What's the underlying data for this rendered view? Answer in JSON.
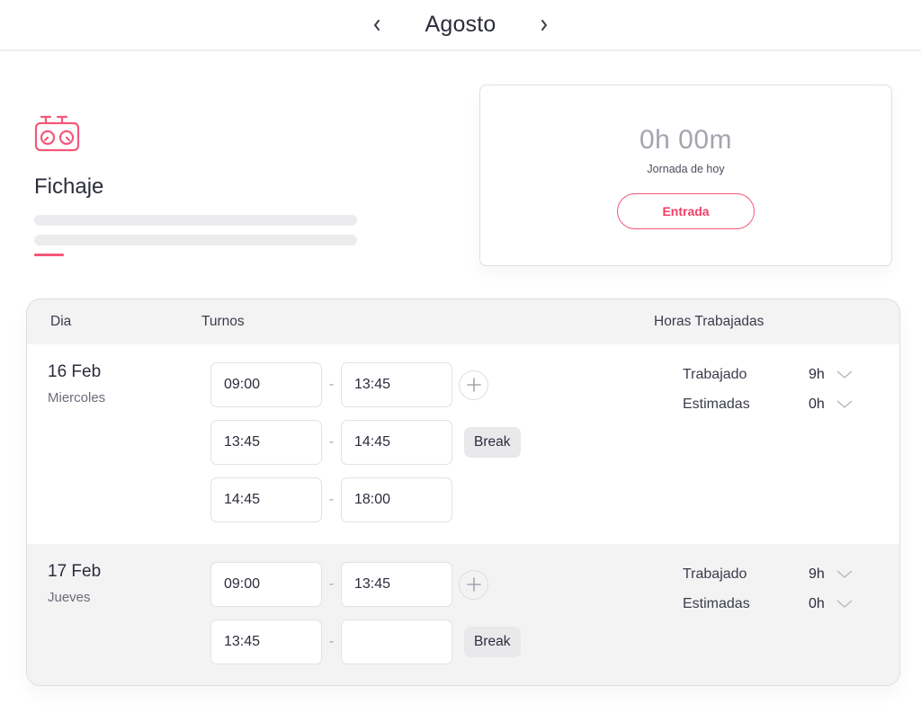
{
  "header": {
    "prev_icon": "chevron-left-icon",
    "month": "Agosto",
    "next_icon": "chevron-right-icon"
  },
  "hero": {
    "icon": "chess-clock-icon",
    "title": "Fichaje",
    "accent_color": "#f5587a"
  },
  "today": {
    "time": "0h 00m",
    "label": "Jornada de hoy",
    "button_label": "Entrada"
  },
  "table": {
    "headers": {
      "day": "Dia",
      "shifts": "Turnos",
      "hours": "Horas Trabajadas"
    },
    "rows": [
      {
        "date": "16 Feb",
        "weekday": "Miercoles",
        "shifts": [
          {
            "start": "09:00",
            "end": "13:45",
            "action": "add"
          },
          {
            "start": "13:45",
            "end": "14:45",
            "action": "break"
          },
          {
            "start": "14:45",
            "end": "18:00",
            "action": ""
          }
        ],
        "worked_label": "Trabajado",
        "worked_value": "9h",
        "estimated_label": "Estimadas",
        "estimated_value": "0h"
      },
      {
        "date": "17 Feb",
        "weekday": "Jueves",
        "shifts": [
          {
            "start": "09:00",
            "end": "13:45",
            "action": "add"
          },
          {
            "start": "13:45",
            "end": "",
            "action": "break"
          }
        ],
        "worked_label": "Trabajado",
        "worked_value": "9h",
        "estimated_label": "Estimadas",
        "estimated_value": "0h"
      }
    ],
    "break_label": "Break"
  }
}
